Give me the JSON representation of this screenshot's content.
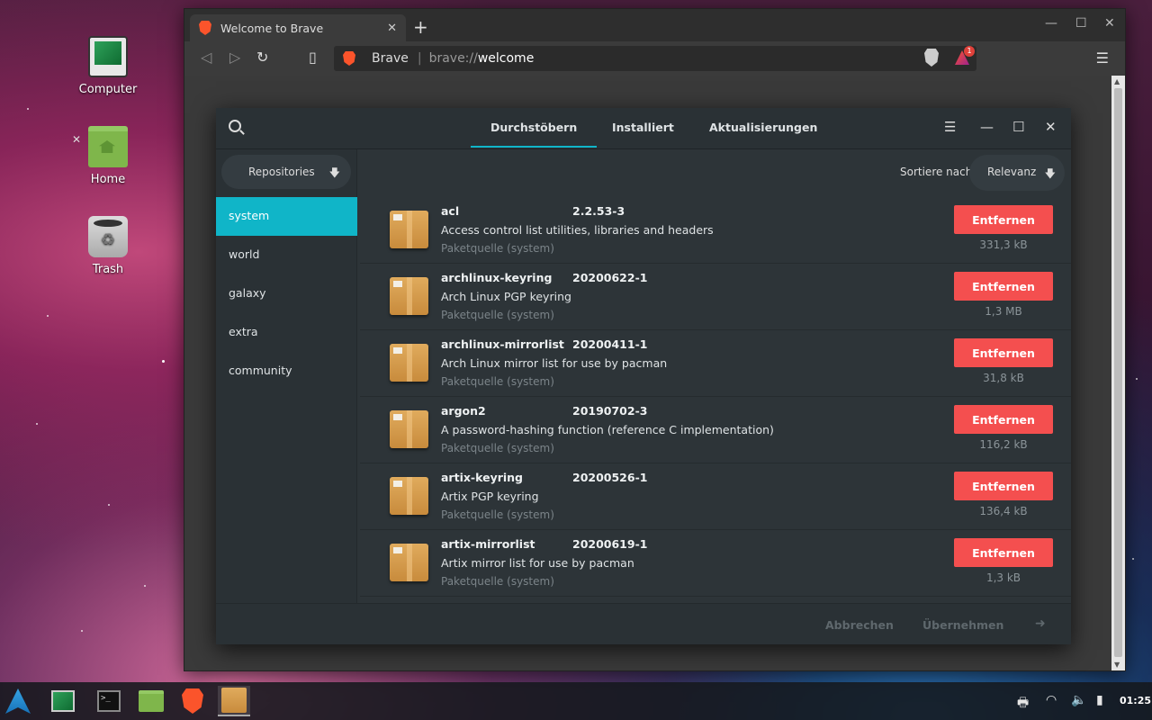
{
  "desktop": {
    "icons": [
      {
        "label": "Computer"
      },
      {
        "label": "Home"
      },
      {
        "label": "Trash"
      }
    ]
  },
  "browser": {
    "tab_title": "Welcome to Brave",
    "url_site": "Brave",
    "url_scheme": "brave://",
    "url_path": "welcome",
    "rewards_badge": "1"
  },
  "pamac": {
    "tabs": [
      "Durchstöbern",
      "Installiert",
      "Aktualisierungen"
    ],
    "active_tab": "Durchstöbern",
    "repo_dropdown": "Repositories",
    "repos": [
      "system",
      "world",
      "galaxy",
      "extra",
      "community"
    ],
    "active_repo": "system",
    "sort_label": "Sortiere nach",
    "sort_value": "Relevanz",
    "packages": [
      {
        "name": "acl",
        "version": "2.2.53-3",
        "description": "Access control list utilities, libraries and headers",
        "source": "Paketquelle (system)",
        "action": "Entfernen",
        "size": "331,3 kB"
      },
      {
        "name": "archlinux-keyring",
        "version": "20200622-1",
        "description": "Arch Linux PGP keyring",
        "source": "Paketquelle (system)",
        "action": "Entfernen",
        "size": "1,3 MB"
      },
      {
        "name": "archlinux-mirrorlist",
        "version": "20200411-1",
        "description": "Arch Linux mirror list for use by pacman",
        "source": "Paketquelle (system)",
        "action": "Entfernen",
        "size": "31,8 kB"
      },
      {
        "name": "argon2",
        "version": "20190702-3",
        "description": "A password-hashing function (reference C implementation)",
        "source": "Paketquelle (system)",
        "action": "Entfernen",
        "size": "116,2 kB"
      },
      {
        "name": "artix-keyring",
        "version": "20200526-1",
        "description": "Artix PGP keyring",
        "source": "Paketquelle (system)",
        "action": "Entfernen",
        "size": "136,4 kB"
      },
      {
        "name": "artix-mirrorlist",
        "version": "20200619-1",
        "description": "Artix mirror list for use by pacman",
        "source": "Paketquelle (system)",
        "action": "Entfernen",
        "size": "1,3 kB"
      }
    ],
    "footer": {
      "cancel": "Abbrechen",
      "apply": "Übernehmen"
    }
  },
  "taskbar": {
    "clock": "01:25"
  },
  "colors": {
    "accent": "#10b5c8",
    "remove_button": "#f44f4f",
    "brave": "#fb542b"
  }
}
